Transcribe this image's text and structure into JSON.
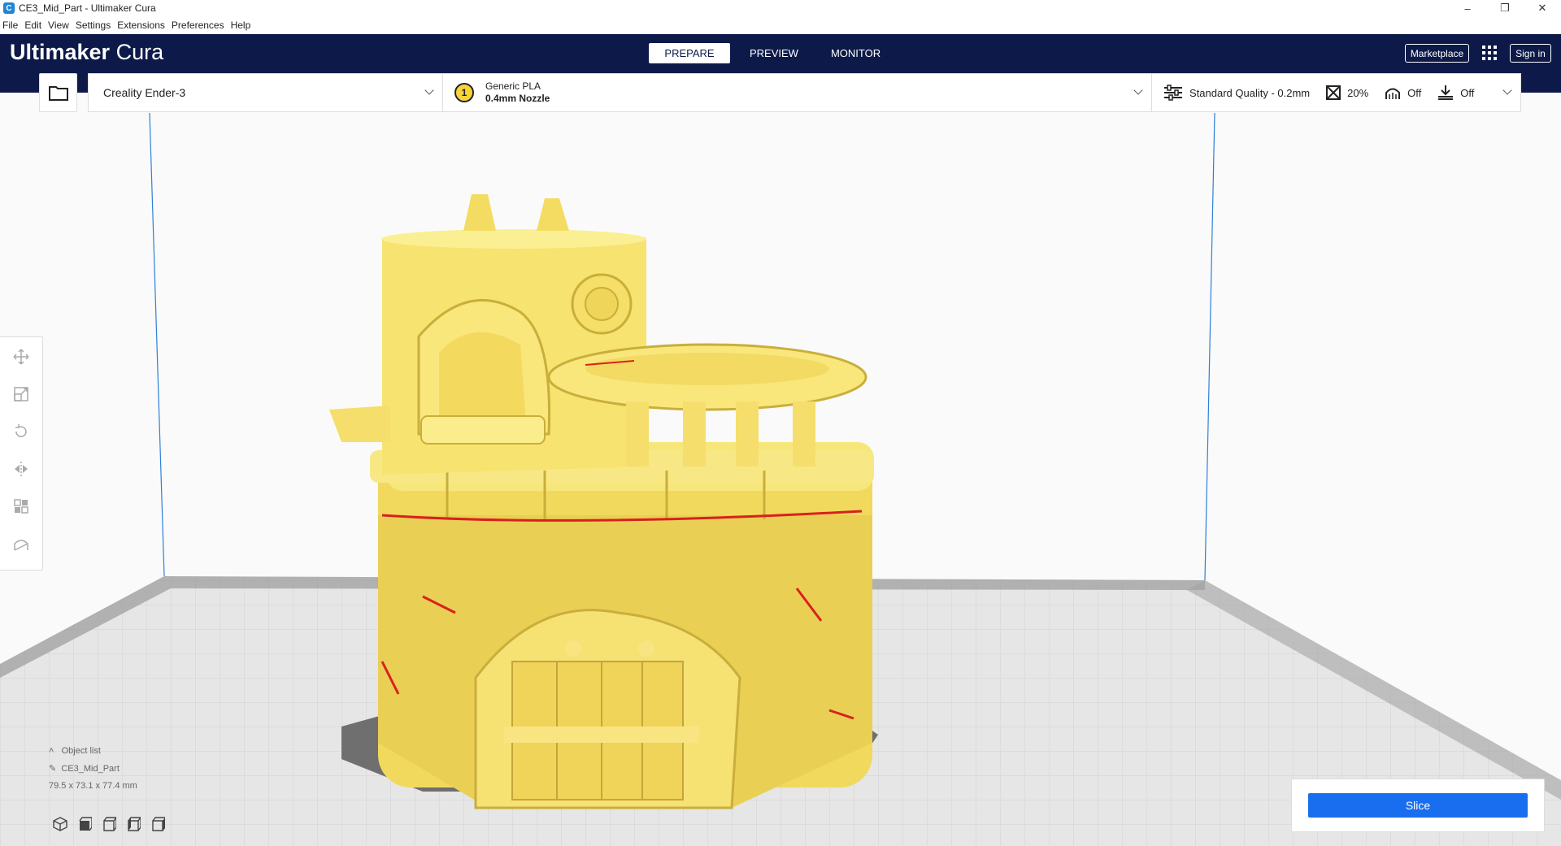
{
  "window": {
    "title": "CE3_Mid_Part - Ultimaker Cura",
    "controls": [
      "minimize-icon",
      "restore-icon",
      "close-icon"
    ]
  },
  "menu": [
    "File",
    "Edit",
    "View",
    "Settings",
    "Extensions",
    "Preferences",
    "Help"
  ],
  "header": {
    "logo_bold": "Ultimaker",
    "logo_light": "Cura",
    "tabs": [
      "PREPARE",
      "PREVIEW",
      "MONITOR"
    ],
    "active_tab": "PREPARE",
    "marketplace_label": "Marketplace",
    "signin_label": "Sign in"
  },
  "toolbar": {
    "printer": "Creality Ender-3",
    "extruder_number": "1",
    "material": "Generic PLA",
    "nozzle": "0.4mm Nozzle",
    "quality": "Standard Quality - 0.2mm",
    "infill": "20%",
    "support": "Off",
    "adhesion": "Off"
  },
  "tools": [
    "move-icon",
    "scale-icon",
    "rotate-icon",
    "mirror-icon",
    "per-model-settings-icon",
    "support-blocker-icon"
  ],
  "object_list": {
    "label": "Object list",
    "object_name": "CE3_Mid_Part",
    "dimensions": "79.5 x 73.1 x 77.4 mm"
  },
  "slice": {
    "button_label": "Slice"
  },
  "colors": {
    "header": "#0d1a49",
    "model": "#f5e26b",
    "slice_button": "#196ef0",
    "overhang": "#d8211d"
  }
}
